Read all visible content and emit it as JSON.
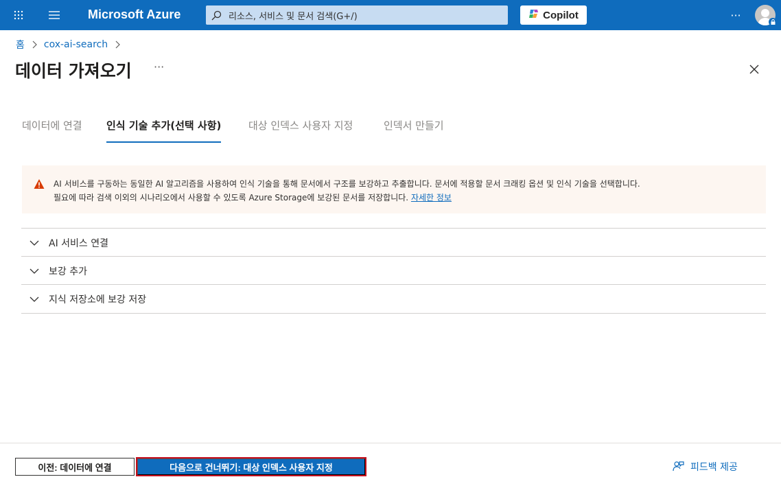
{
  "topbar": {
    "brand": "Microsoft Azure",
    "search_placeholder": "리소스, 서비스 및 문서 검색(G+/)",
    "copilot_label": "Copilot",
    "more_label": "···",
    "accent_color": "#0f6cbd"
  },
  "breadcrumb": {
    "items": [
      "홈",
      "cox-ai-search"
    ]
  },
  "page": {
    "title": "데이터 가져오기",
    "more_label": "···"
  },
  "tabs": [
    {
      "label": "데이터에 연결",
      "active": false
    },
    {
      "label": "인식 기술 추가(선택 사항)",
      "active": true
    },
    {
      "label": "대상 인덱스 사용자 지정",
      "active": false
    },
    {
      "label": "인덱서 만들기",
      "active": false
    }
  ],
  "warning": {
    "line1": "AI 서비스를 구동하는 동일한 AI 알고리즘을 사용하여 인식 기술을 통해 문서에서 구조를 보강하고 추출합니다. 문서에 적용할 문서 크래킹 옵션 및 인식 기술을 선택합니다.",
    "line2": "필요에 따라 검색 이외의 시나리오에서 사용할 수 있도록 Azure Storage에 보강된 문서를 저장합니다.",
    "link": "자세한 정보",
    "icon": "warning-icon",
    "icon_color": "#d83b01"
  },
  "sections": [
    {
      "label": "AI 서비스 연결"
    },
    {
      "label": "보강 추가"
    },
    {
      "label": "지식 저장소에 보강 저장"
    }
  ],
  "footer": {
    "prev_label": "이전: 데이터에 연결",
    "next_label": "다음으로 건너뛰기: 대상 인덱스 사용자 지정",
    "feedback_label": "피드백 제공"
  }
}
